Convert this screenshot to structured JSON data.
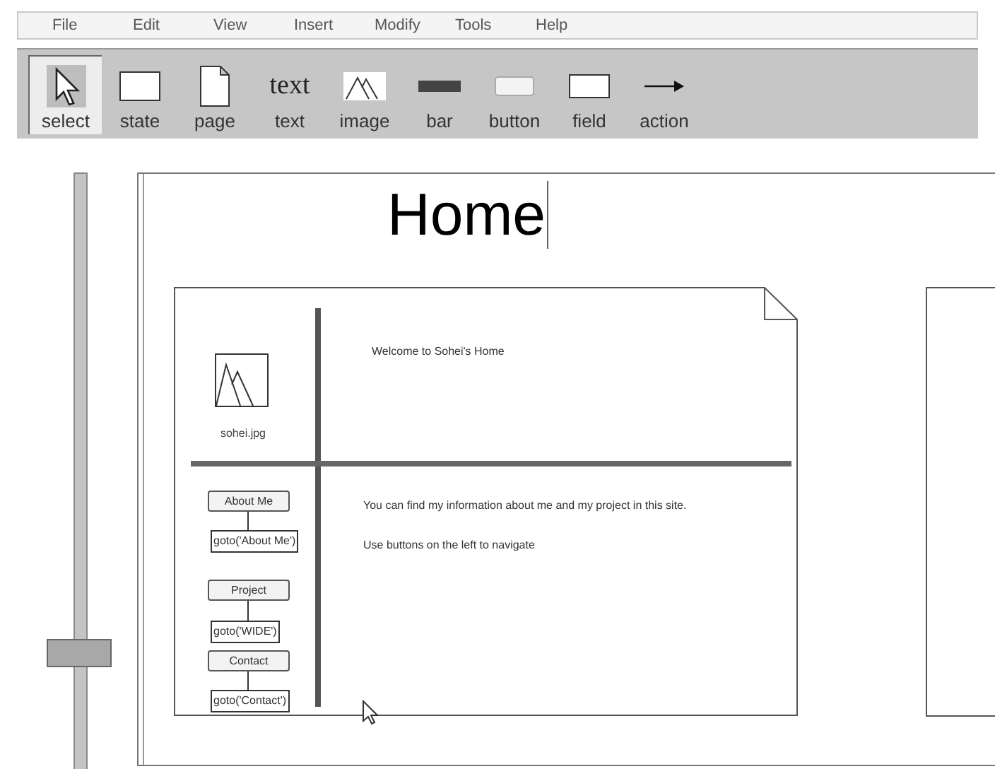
{
  "menu": [
    "File",
    "Edit",
    "View",
    "Insert",
    "Modify",
    "Tools",
    "Help"
  ],
  "tools": [
    {
      "label": "select",
      "selected": true
    },
    {
      "label": "state",
      "selected": false
    },
    {
      "label": "page",
      "selected": false
    },
    {
      "label": "text",
      "selected": false,
      "glyph": "text"
    },
    {
      "label": "image",
      "selected": false
    },
    {
      "label": "bar",
      "selected": false
    },
    {
      "label": "button",
      "selected": false
    },
    {
      "label": "field",
      "selected": false
    },
    {
      "label": "action",
      "selected": false
    }
  ],
  "canvas": {
    "title": "Home",
    "page": {
      "image_name": "sohei.jpg",
      "welcome": "Welcome to Sohei's Home",
      "body": [
        "You can find my information about me and my project in this site.",
        "Use buttons on the left to navigate"
      ],
      "buttons": [
        {
          "label": "About Me",
          "action": "goto('About Me')"
        },
        {
          "label": "Project",
          "action": "goto('WIDE')"
        },
        {
          "label": "Contact",
          "action": "goto('Contact')"
        }
      ]
    }
  }
}
